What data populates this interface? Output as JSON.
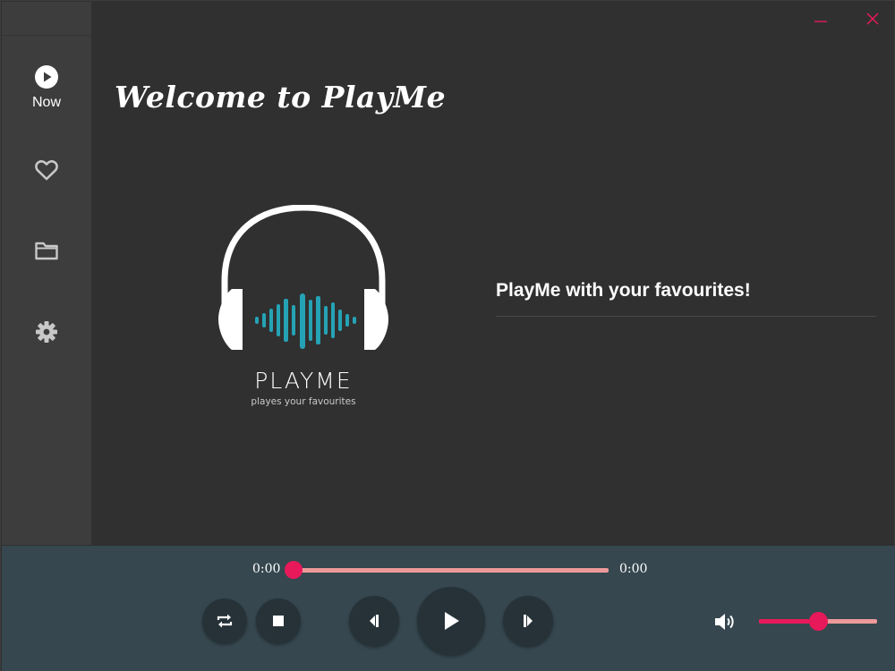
{
  "window": {
    "minimize_icon": "minimize-icon",
    "close_icon": "close-icon",
    "accent_color": "#e8195a"
  },
  "sidebar": {
    "items": [
      {
        "label": "Now",
        "icon": "play-circle-icon",
        "active": true
      },
      {
        "label": "",
        "icon": "heart-icon"
      },
      {
        "label": "",
        "icon": "folder-icon"
      },
      {
        "label": "",
        "icon": "gear-icon"
      }
    ]
  },
  "main": {
    "welcome_title": "Welcome to PlayMe",
    "logo_brand": "PLAYME",
    "logo_tagline": "playes your favourites",
    "tagline": "PlayMe with your favourites!"
  },
  "player": {
    "current_time": "0:00",
    "total_time": "0:00",
    "progress": 0.0,
    "volume": 0.5,
    "buttons": [
      "repeat-icon",
      "stop-icon",
      "previous-icon",
      "play-icon",
      "next-icon",
      "volume-icon"
    ]
  }
}
